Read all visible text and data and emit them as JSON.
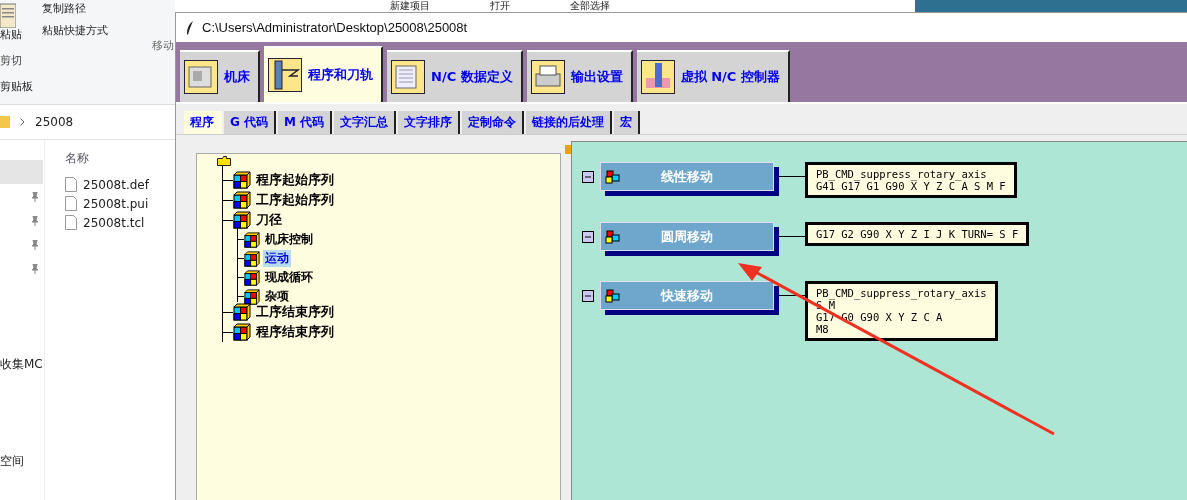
{
  "explorer": {
    "ribbon": {
      "top_items": [
        "新建项目",
        "打开",
        "全部选择"
      ],
      "paste": "粘贴",
      "copy_path": "复制路径",
      "paste_shortcut": "粘贴快捷方式",
      "cut": "剪切",
      "move": "移动",
      "group": "剪贴板"
    },
    "address": "25008",
    "nav_items": [
      "收集MC",
      "空间"
    ],
    "column": "名称",
    "files": [
      "25008t.def",
      "25008t.pui",
      "25008t.tcl"
    ]
  },
  "window": {
    "title": "C:\\Users\\Administrator\\Desktop\\25008\\25008t",
    "tabs": [
      {
        "label": "机床",
        "selected": false
      },
      {
        "label": "程序和刀轨",
        "selected": true
      },
      {
        "label": "N/C 数据定义",
        "selected": false
      },
      {
        "label": "输出设置",
        "selected": false
      },
      {
        "label": "虚拟 N/C 控制器",
        "selected": false
      }
    ],
    "subtabs": [
      {
        "label": "程序",
        "selected": true
      },
      {
        "label": "G 代码",
        "selected": false
      },
      {
        "label": "M 代码",
        "selected": false
      },
      {
        "label": "文字汇总",
        "selected": false
      },
      {
        "label": "文字排序",
        "selected": false
      },
      {
        "label": "定制命令",
        "selected": false
      },
      {
        "label": "链接的后处理",
        "selected": false
      },
      {
        "label": "宏",
        "selected": false
      }
    ],
    "tree": [
      {
        "label": "程序起始序列",
        "selected": false
      },
      {
        "label": "工序起始序列",
        "selected": false
      },
      {
        "label": "刀径",
        "selected": false,
        "children": [
          {
            "label": "机床控制",
            "selected": false
          },
          {
            "label": "运动",
            "selected": true
          },
          {
            "label": "现成循环",
            "selected": false
          },
          {
            "label": "杂项",
            "selected": false
          }
        ]
      },
      {
        "label": "工序结束序列",
        "selected": false
      },
      {
        "label": "程序结束序列",
        "selected": false
      }
    ],
    "blocks": [
      {
        "label": "线性移动",
        "code": [
          "PB_CMD_suppress_rotary_axis",
          "G41 G17 G1 G90 X Y Z C A S M F"
        ]
      },
      {
        "label": "圆周移动",
        "code": [
          "G17 G2 G90 X Y Z I J K TURN= S F"
        ]
      },
      {
        "label": "快速移动",
        "code": [
          "PB_CMD_suppress_rotary_axis",
          "S M",
          "G17 G0 G90 X Y Z C A",
          "M8"
        ]
      }
    ]
  }
}
